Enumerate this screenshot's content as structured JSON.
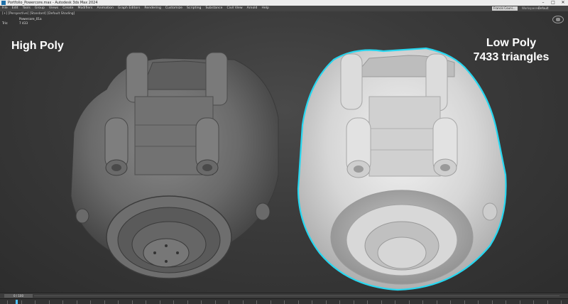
{
  "window": {
    "title": "Portfolio_Powercore.max - Autodesk 3ds Max 2024"
  },
  "menu": [
    "File",
    "Edit",
    "Tools",
    "Group",
    "Views",
    "Create",
    "Modifiers",
    "Animation",
    "Graph Editors",
    "Rendering",
    "Customize",
    "Scripting",
    "Substance",
    "Civil View",
    "Arnold",
    "Help"
  ],
  "user": {
    "name": "Francis Couni...",
    "workspace_label": "Workspaces:",
    "workspace_value": "Default"
  },
  "viewport": {
    "label": "[+] [Perspective] [Standard] [Default Shading]",
    "stats": [
      {
        "key": "",
        "value": "Powercore_01a"
      },
      {
        "key": "Tris:",
        "value": "7 433"
      }
    ]
  },
  "annotations": {
    "high": "High Poly",
    "low_line1": "Low Poly",
    "low_line2": "7433 triangles"
  },
  "timeline": {
    "frame": "0 / 100"
  },
  "colors": {
    "selection_outline": "#27d7f0",
    "viewport_bg": "#3a3a3a",
    "text": "#ffffff"
  }
}
